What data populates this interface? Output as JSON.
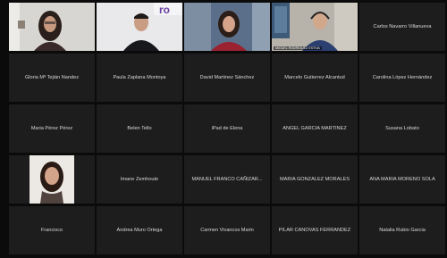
{
  "participants": [
    {
      "name": "",
      "video": "woman-glasses-dark-hair"
    },
    {
      "name": "",
      "video": "young-man-dark-shirt"
    },
    {
      "name": "",
      "video": "woman-red-top"
    },
    {
      "name": "",
      "video": "man-with-headset",
      "caption": "MIGUEL RODRIGUEZ ESTIVA"
    },
    {
      "name": "Carlos Navarro Villanueva"
    },
    {
      "name": "Gloria Mª Tejián Nandez"
    },
    {
      "name": "Paula Zaplana Montoya"
    },
    {
      "name": "David Martinez Sánchez"
    },
    {
      "name": "Marcelo Gutierrez Alcantud"
    },
    {
      "name": "Carolina López Hernández"
    },
    {
      "name": "Maria Pérez Pérez"
    },
    {
      "name": "Belen Tello"
    },
    {
      "name": "iPad de Elena"
    },
    {
      "name": "ANGEL GARCIA MARTINEZ"
    },
    {
      "name": "Susana Lobato"
    },
    {
      "name": "",
      "video": "profile-photo-woman"
    },
    {
      "name": "Imane Zemhoute"
    },
    {
      "name": "MANUEL FRANCO CAÑIZAR..."
    },
    {
      "name": "MARIA GONZALEZ MORALES"
    },
    {
      "name": "ANA MARIA MORENO SOLA"
    },
    {
      "name": "Francisco"
    },
    {
      "name": "Andrea Muro Ortega"
    },
    {
      "name": "Carmen Vivancos Marin"
    },
    {
      "name": "PILAR CANOVAS FERRANDEZ"
    },
    {
      "name": "Natalia Rubio Garcia"
    }
  ]
}
